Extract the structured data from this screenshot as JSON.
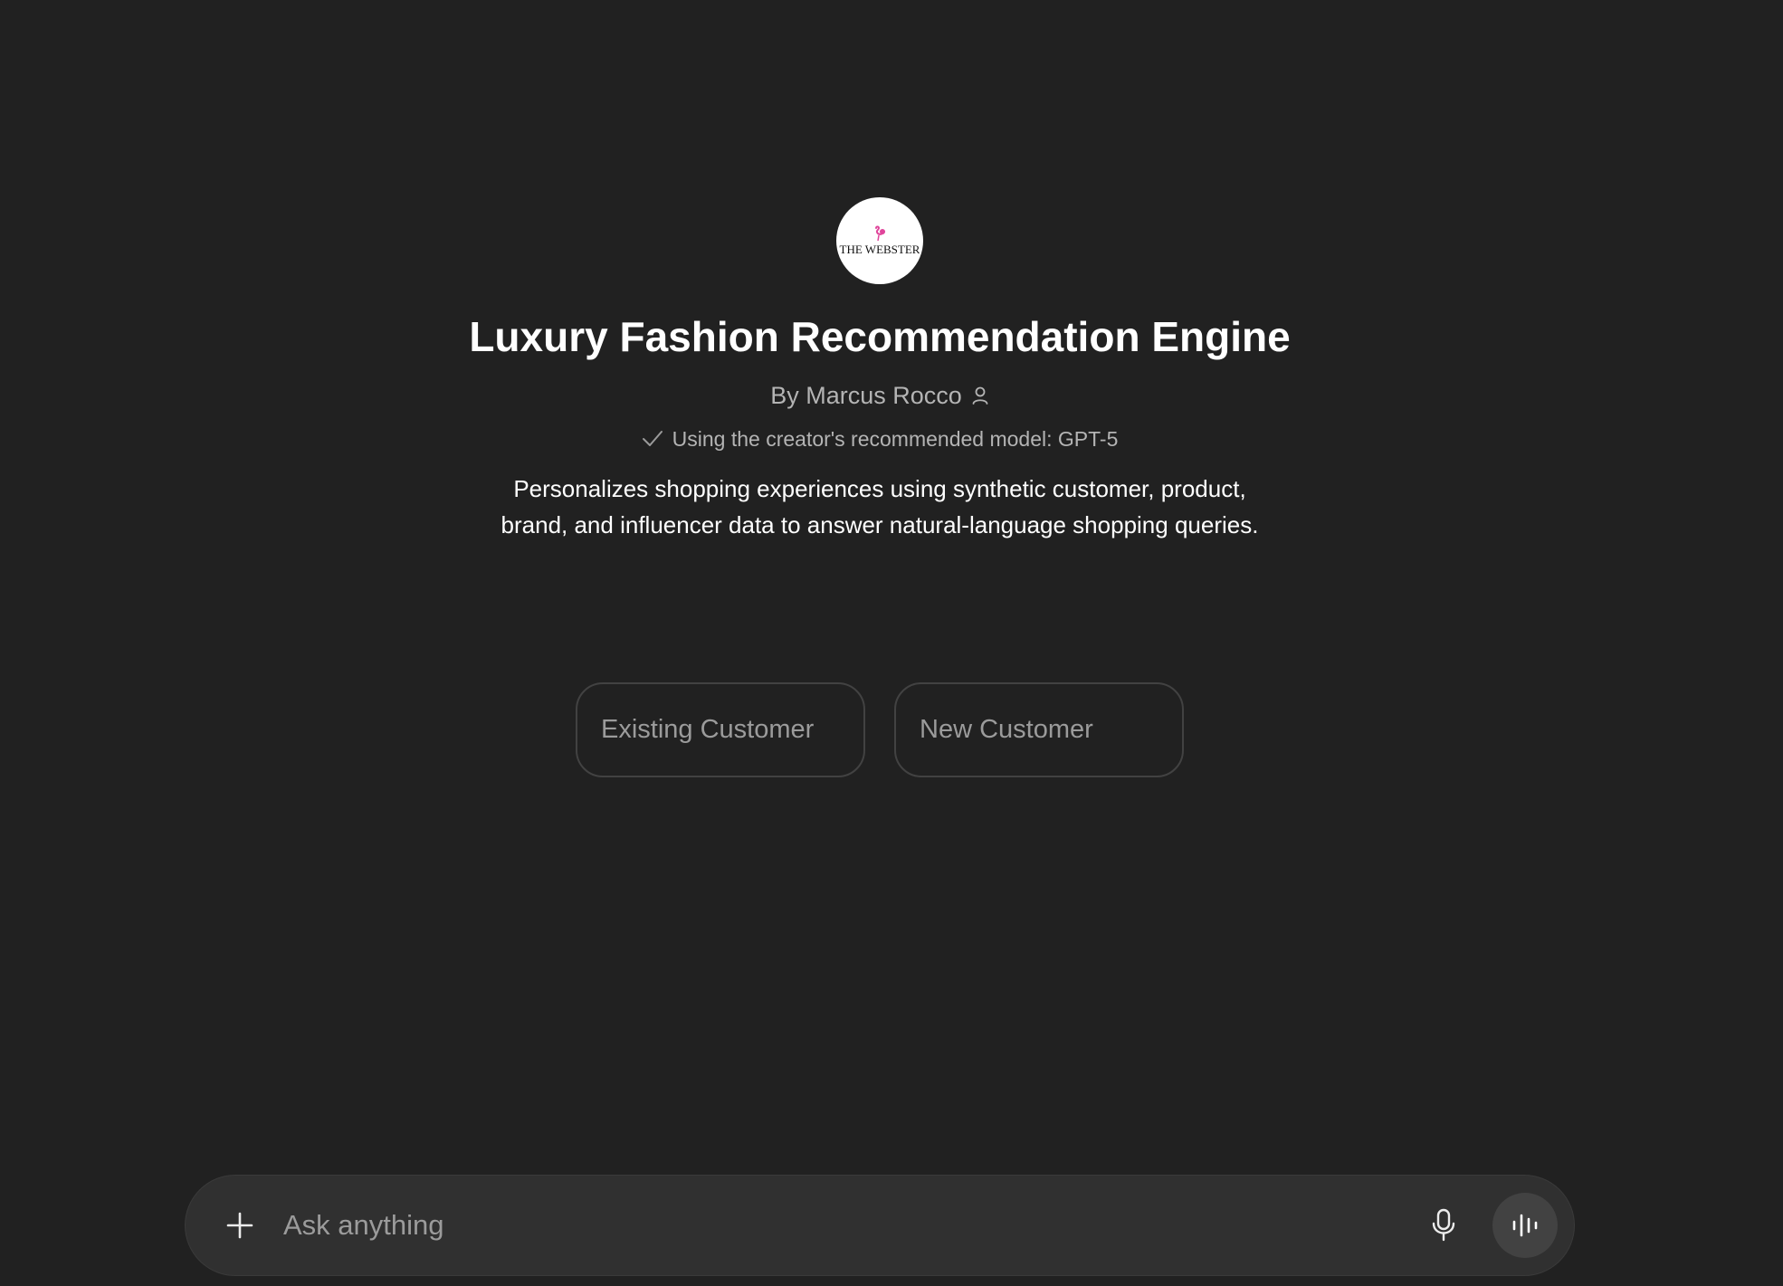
{
  "gpt": {
    "logo_text": "THE WEBSTER",
    "title": "Luxury Fashion Recommendation Engine",
    "author": "By Marcus Rocco",
    "model_note": "Using the creator's recommended model: GPT-5",
    "description": "Personalizes shopping experiences using synthetic customer, product, brand, and influencer data to answer natural-language shopping queries."
  },
  "starters": [
    {
      "label": "Existing Customer"
    },
    {
      "label": "New Customer"
    }
  ],
  "composer": {
    "placeholder": "Ask anything",
    "icons": [
      "plus-icon",
      "microphone-icon",
      "voice-waveform-icon"
    ]
  },
  "colors": {
    "background": "#212121",
    "composer": "#303030",
    "logo_accent": "#e0459b"
  }
}
